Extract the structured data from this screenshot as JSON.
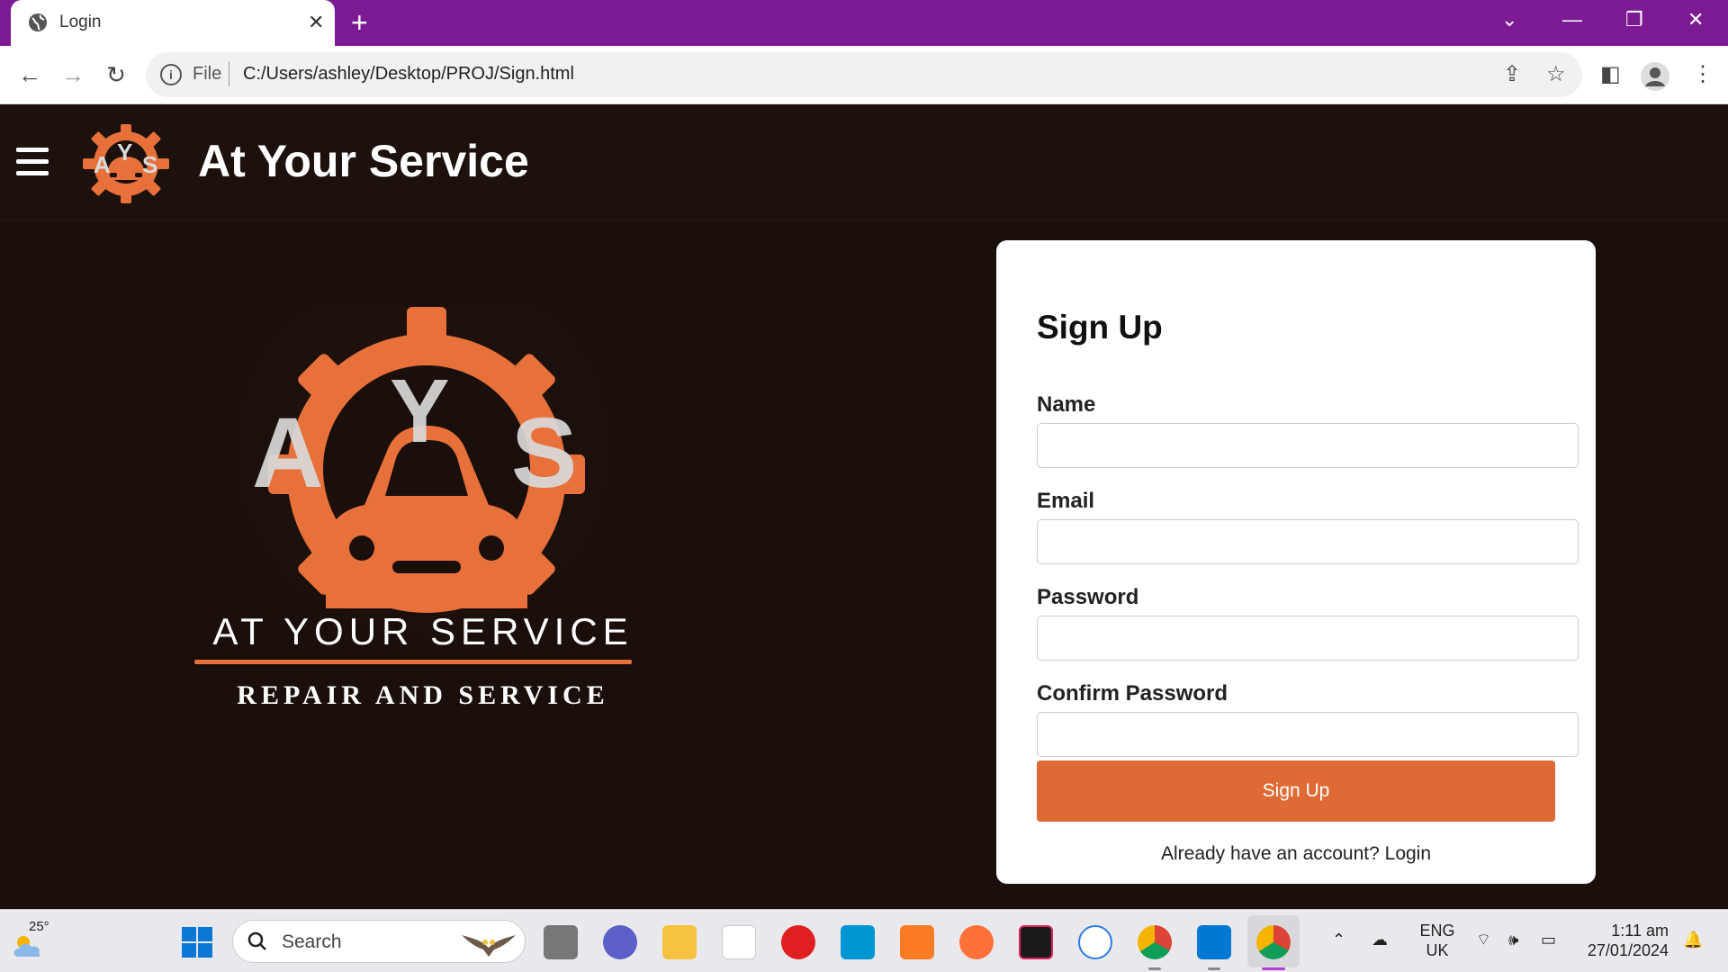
{
  "browser": {
    "tab_title": "Login",
    "address_label": "File",
    "url": "C:/Users/ashley/Desktop/PROJ/Sign.html"
  },
  "header": {
    "site_title": "At Your Service"
  },
  "logo": {
    "letters": [
      "A",
      "Y",
      "S"
    ],
    "tagline": "AT YOUR SERVICE",
    "subtagline": "REPAIR AND SERVICE",
    "colors": {
      "gear": "#e8703a",
      "letters": "#d9d9d9",
      "text": "#ffffff"
    }
  },
  "form": {
    "heading": "Sign Up",
    "name_label": "Name",
    "email_label": "Email",
    "password_label": "Password",
    "confirm_label": "Confirm Password",
    "submit_label": "Sign Up",
    "footer_text": "Already have an account? Login",
    "accent_color": "#e06a35"
  },
  "taskbar": {
    "weather_temp": "25°",
    "search_placeholder": "Search",
    "lang_primary": "ENG",
    "lang_secondary": "UK",
    "time": "1:11 am",
    "date": "27/01/2024"
  }
}
